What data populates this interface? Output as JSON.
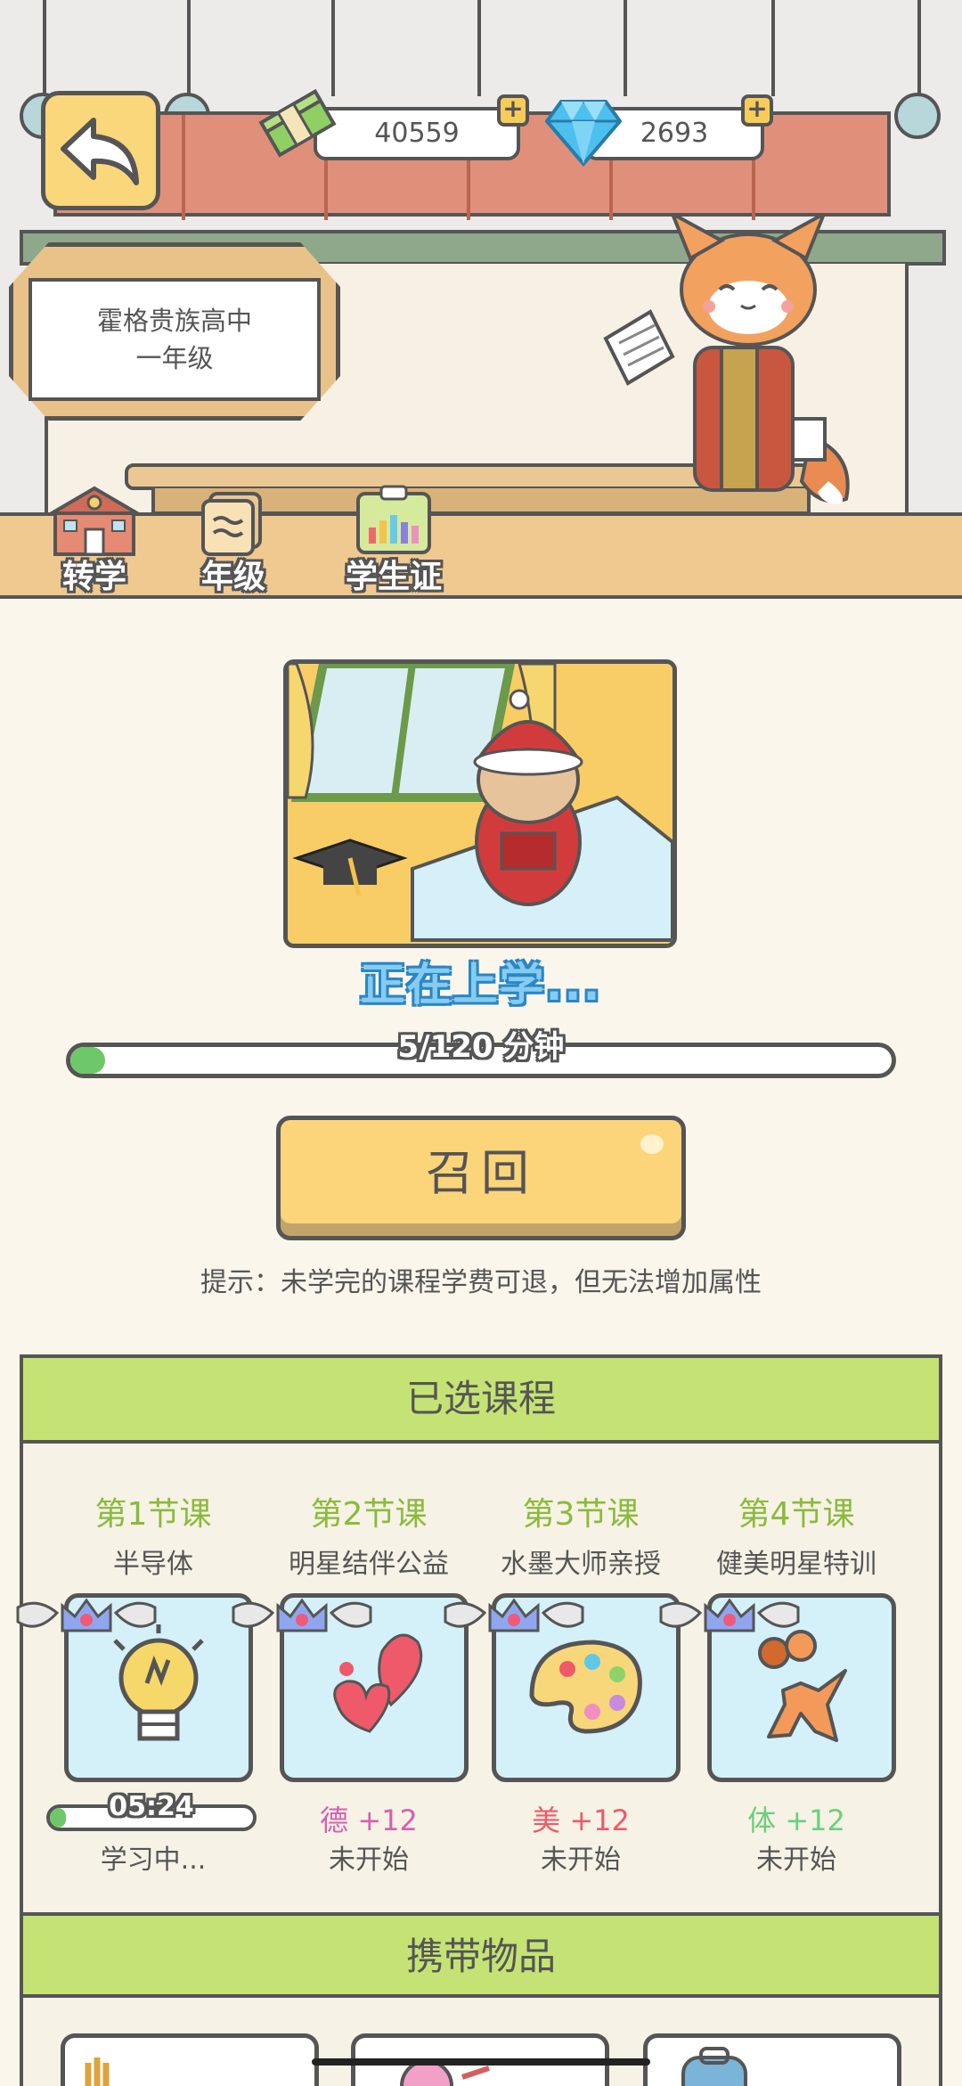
{
  "currency": {
    "cash": "40559",
    "gems": "2693",
    "plus": "+"
  },
  "school": {
    "name": "霍格贵族高中",
    "grade": "一年级"
  },
  "nav": [
    {
      "label": "转学"
    },
    {
      "label": "年级"
    },
    {
      "label": "学生证"
    }
  ],
  "study": {
    "status": "正在上学...",
    "progress_text": "5/120 分钟",
    "progress_fraction": 0.042,
    "recall_label": "召回",
    "hint": "提示：未学完的课程学费可退，但无法增加属性"
  },
  "courses": {
    "title": "已选课程",
    "items": [
      {
        "num": "第1节课",
        "name": "半导体",
        "icon": "lightbulb-icon",
        "timer": "05:24",
        "timer_fraction": 0.08,
        "state": "学习中..."
      },
      {
        "num": "第2节课",
        "name": "明星结伴公益",
        "icon": "hearts-icon",
        "attr": "德 +12",
        "attr_color": "#d65fb0",
        "state": "未开始"
      },
      {
        "num": "第3节课",
        "name": "水墨大师亲授",
        "icon": "palette-icon",
        "attr": "美 +12",
        "attr_color": "#ee5a6a",
        "state": "未开始"
      },
      {
        "num": "第4节课",
        "name": "健美明星特训",
        "icon": "athlete-icon",
        "attr": "体 +12",
        "attr_color": "#6ccf7a",
        "state": "未开始"
      }
    ]
  },
  "items_section": {
    "title": "携带物品"
  }
}
